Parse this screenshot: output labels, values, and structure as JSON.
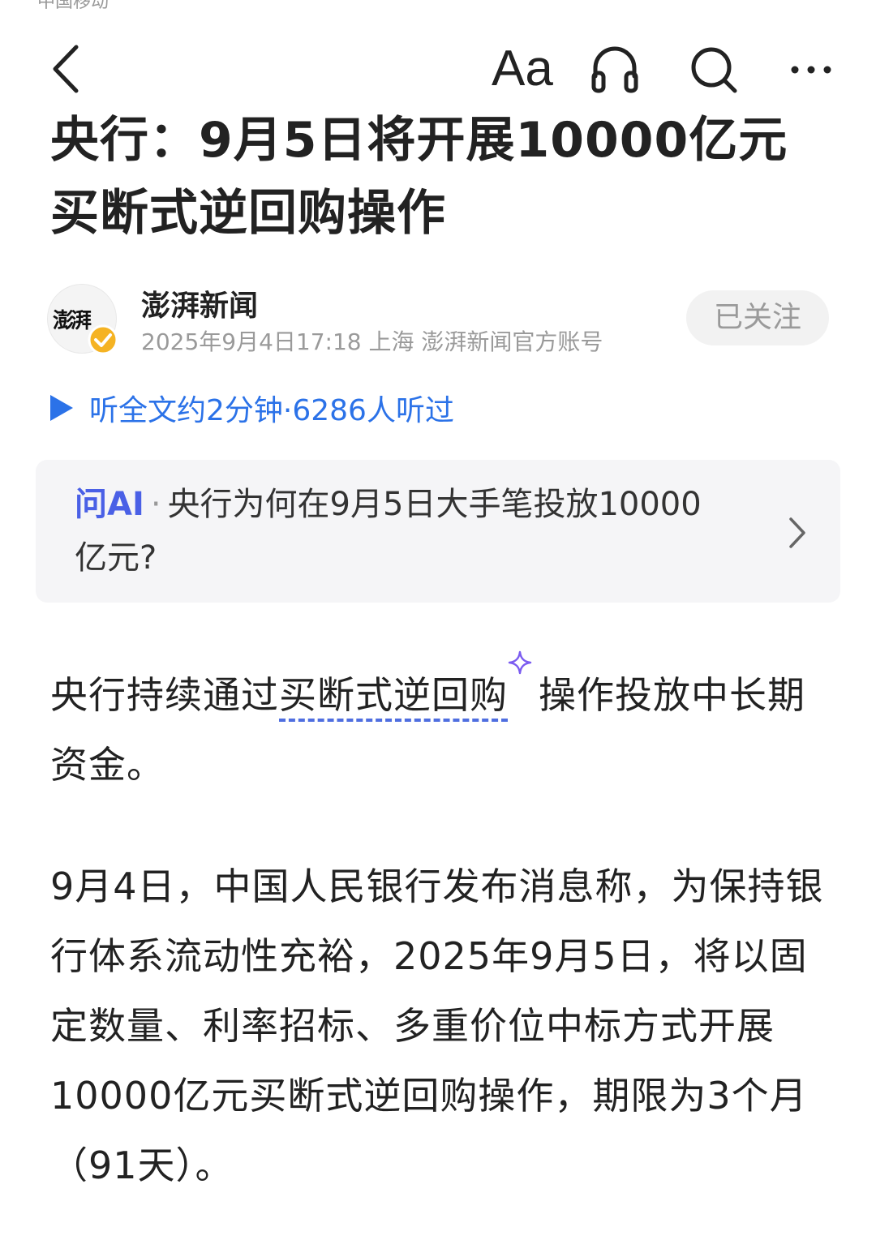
{
  "status": {
    "carrier": "中国移动"
  },
  "toolbar": {
    "font_label": "Aa",
    "back_icon": "back-chevron-icon",
    "listen_icon": "headphones-icon",
    "search_icon": "search-icon",
    "more_icon": "more-icon"
  },
  "article": {
    "title": "央行：9月5日将开展10000亿元买断式逆回购操作",
    "author_logo_text": "澎湃",
    "author_name": "澎湃新闻",
    "meta": "2025年9月4日17:18 上海 澎湃新闻官方账号",
    "follow_label": "已关注",
    "listen_text": "听全文约2分钟·6286人听过",
    "ai_label": "问AI",
    "ai_dot": "·",
    "ai_question": "央行为何在9月5日大手笔投放10000亿元?",
    "para1_before": "央行持续通过",
    "para1_link": "买断式逆回购",
    "para1_after": "操作投放中长期资金。",
    "para2": "9月4日，中国人民银行发布消息称，为保持银行体系流动性充裕，2025年9月5日，将以固定数量、利率招标、多重价位中标方式开展10000亿元买断式逆回购操作，期限为3个月（91天）。"
  },
  "colors": {
    "accent_blue": "#2b72e8",
    "ai_purple": "#4a60e6",
    "verified_gold": "#f5b323"
  }
}
